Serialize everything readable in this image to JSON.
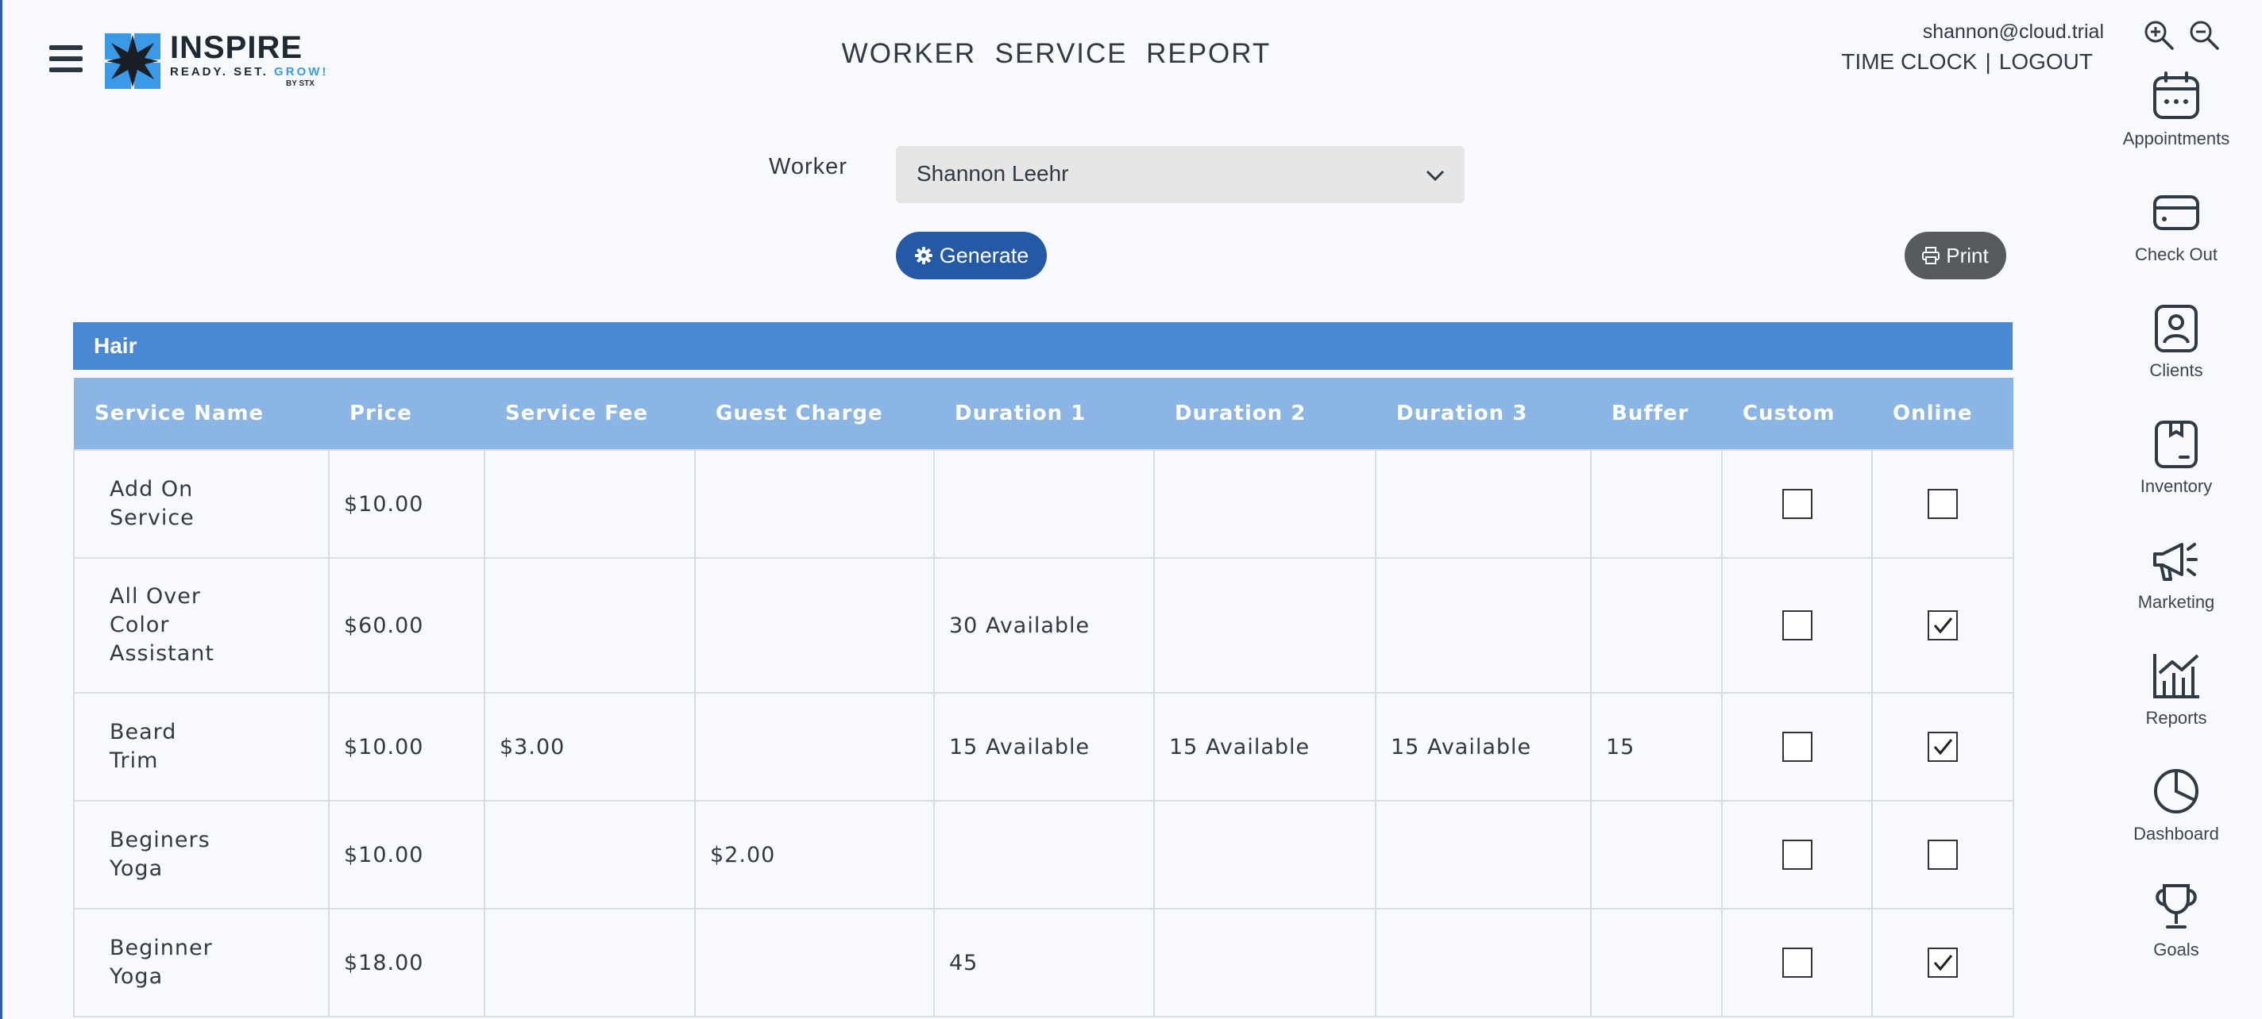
{
  "brand": {
    "name": "INSPIRE",
    "tagline_a": "READY. SET. ",
    "tagline_b": "GROW!",
    "by_line": "BY STX"
  },
  "header": {
    "title": "WORKER  SERVICE  REPORT",
    "user_email": "shannon@cloud.trial",
    "time_clock": "TIME CLOCK",
    "separator": "|",
    "logout": "LOGOUT"
  },
  "side_nav": [
    {
      "label": "Appointments",
      "icon": "calendar-icon"
    },
    {
      "label": "Check Out",
      "icon": "credit-card-icon"
    },
    {
      "label": "Clients",
      "icon": "client-badge-icon"
    },
    {
      "label": "Inventory",
      "icon": "inventory-box-icon"
    },
    {
      "label": "Marketing",
      "icon": "megaphone-icon"
    },
    {
      "label": "Reports",
      "icon": "bar-chart-icon"
    },
    {
      "label": "Dashboard",
      "icon": "pie-chart-icon"
    },
    {
      "label": "Goals",
      "icon": "trophy-icon"
    }
  ],
  "form": {
    "worker_label": "Worker",
    "worker_value": "Shannon Leehr",
    "generate_label": "Generate",
    "print_label": "Print"
  },
  "section": {
    "title": "Hair"
  },
  "table": {
    "columns": [
      "Service Name",
      "Price",
      "Service Fee",
      "Guest Charge",
      "Duration 1",
      "Duration 2",
      "Duration 3",
      "Buffer",
      "Custom",
      "Online"
    ],
    "rows": [
      {
        "name": [
          "Add On",
          "Service"
        ],
        "price": "$10.00",
        "fee": "",
        "guest": "",
        "d1": "",
        "d2": "",
        "d3": "",
        "buffer": "",
        "custom": false,
        "online": false
      },
      {
        "name": [
          "All Over",
          "Color",
          "Assistant"
        ],
        "price": "$60.00",
        "fee": "",
        "guest": "",
        "d1": "30 Available",
        "d2": "",
        "d3": "",
        "buffer": "",
        "custom": false,
        "online": true
      },
      {
        "name": [
          "Beard",
          "Trim"
        ],
        "price": "$10.00",
        "fee": "$3.00",
        "guest": "",
        "d1": "15 Available",
        "d2": "15 Available",
        "d3": "15 Available",
        "buffer": "15",
        "custom": false,
        "online": true
      },
      {
        "name": [
          "Beginers",
          "Yoga"
        ],
        "price": "$10.00",
        "fee": "",
        "guest": "$2.00",
        "d1": "",
        "d2": "",
        "d3": "",
        "buffer": "",
        "custom": false,
        "online": false
      },
      {
        "name": [
          "Beginner",
          "Yoga"
        ],
        "price": "$18.00",
        "fee": "",
        "guest": "",
        "d1": "45",
        "d2": "",
        "d3": "",
        "buffer": "",
        "custom": false,
        "online": true
      }
    ]
  }
}
